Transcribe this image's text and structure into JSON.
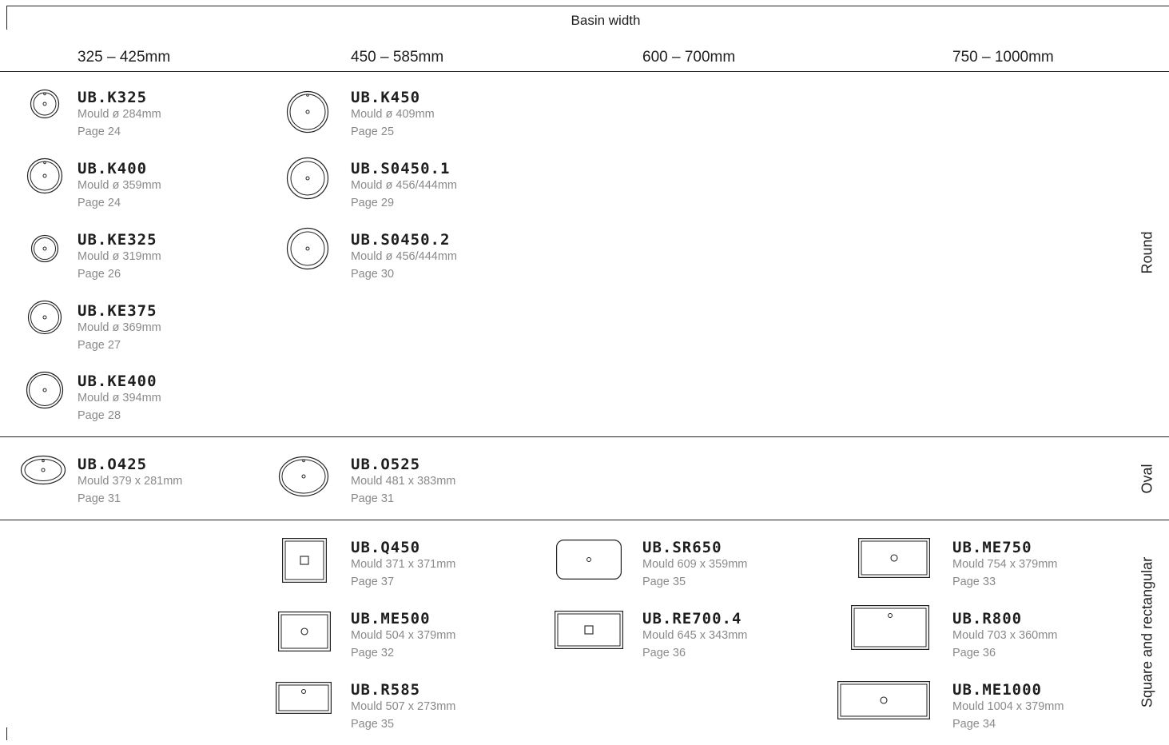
{
  "header": {
    "title": "Basin width",
    "columns": [
      "325 – 425mm",
      "450 – 585mm",
      "600 – 700mm",
      "750 – 1000mm"
    ]
  },
  "rows": [
    {
      "label": "Round",
      "products": [
        {
          "code": "UB.K325",
          "mould": "Mould ø 284mm",
          "page": "Page 24",
          "icon": "round-basin-icon"
        },
        {
          "code": "UB.K400",
          "mould": "Mould ø 359mm",
          "page": "Page 24",
          "icon": "round-basin-icon"
        },
        {
          "code": "UB.KE325",
          "mould": "Mould ø 319mm",
          "page": "Page 26",
          "icon": "round-basin-icon"
        },
        {
          "code": "UB.KE375",
          "mould": "Mould ø 369mm",
          "page": "Page 27",
          "icon": "round-basin-icon"
        },
        {
          "code": "UB.KE400",
          "mould": "Mould ø 394mm",
          "page": "Page 28",
          "icon": "round-basin-icon"
        },
        {
          "code": "UB.K450",
          "mould": "Mould ø 409mm",
          "page": "Page 25",
          "icon": "round-basin-icon"
        },
        {
          "code": "UB.S0450.1",
          "mould": "Mould ø 456/444mm",
          "page": "Page 29",
          "icon": "round-basin-icon"
        },
        {
          "code": "UB.S0450.2",
          "mould": "Mould ø 456/444mm",
          "page": "Page 30",
          "icon": "round-basin-icon"
        }
      ]
    },
    {
      "label": "Oval",
      "products": [
        {
          "code": "UB.O425",
          "mould": "Mould 379 x 281mm",
          "page": "Page 31",
          "icon": "oval-basin-icon"
        },
        {
          "code": "UB.O525",
          "mould": "Mould 481 x 383mm",
          "page": "Page 31",
          "icon": "oval-basin-icon"
        }
      ]
    },
    {
      "label": "Square and rectangular",
      "products": [
        {
          "code": "UB.Q450",
          "mould": "Mould 371 x 371mm",
          "page": "Page 37",
          "icon": "square-basin-icon"
        },
        {
          "code": "UB.ME500",
          "mould": "Mould 504 x 379mm",
          "page": "Page 32",
          "icon": "rectangular-basin-icon"
        },
        {
          "code": "UB.R585",
          "mould": "Mould 507 x 273mm",
          "page": "Page 35",
          "icon": "rectangular-basin-icon"
        },
        {
          "code": "UB.SR650",
          "mould": "Mould 609 x 359mm",
          "page": "Page 35",
          "icon": "rounded-rectangular-basin-icon"
        },
        {
          "code": "UB.RE700.4",
          "mould": "Mould 645 x 343mm",
          "page": "Page 36",
          "icon": "rectangular-basin-icon"
        },
        {
          "code": "UB.ME750",
          "mould": "Mould 754 x 379mm",
          "page": "Page 33",
          "icon": "rectangular-basin-icon"
        },
        {
          "code": "UB.R800",
          "mould": "Mould 703 x 360mm",
          "page": "Page 36",
          "icon": "rectangular-basin-icon"
        },
        {
          "code": "UB.ME1000",
          "mould": "Mould 1004 x 379mm",
          "page": "Page 34",
          "icon": "rectangular-basin-icon"
        }
      ]
    }
  ]
}
